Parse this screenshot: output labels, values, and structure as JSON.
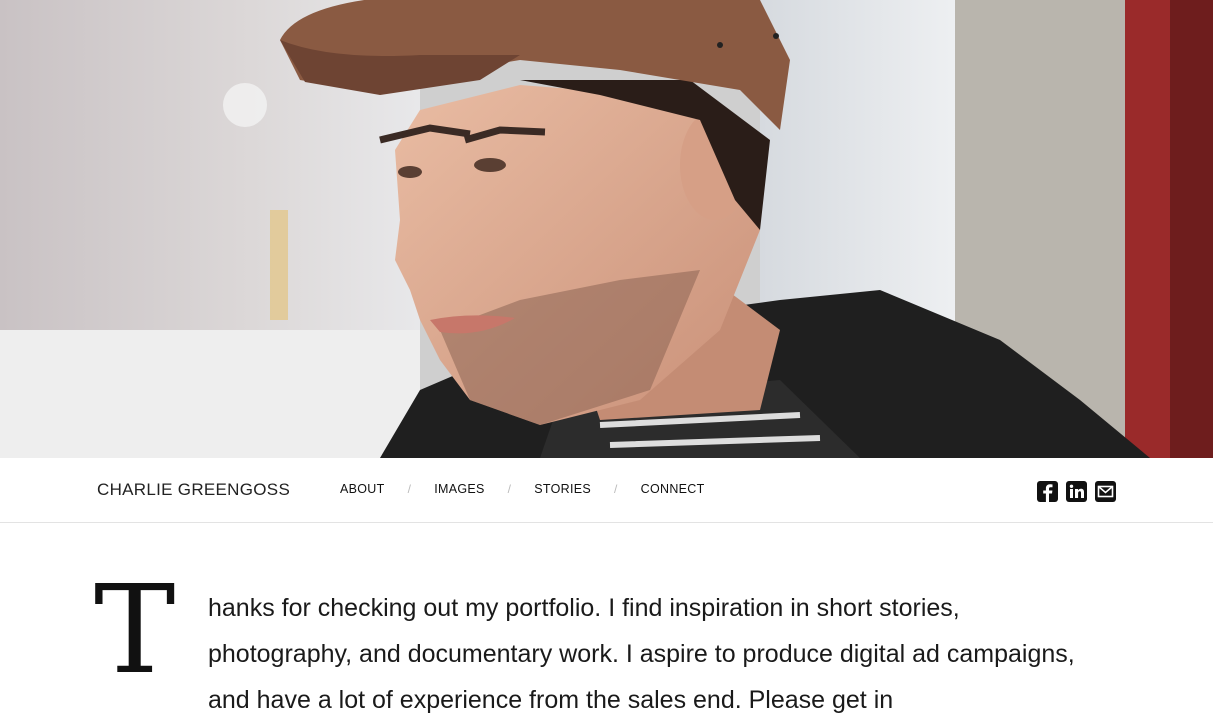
{
  "header": {
    "site_name": "CHARLIE GREENGOSS"
  },
  "nav": {
    "items": [
      {
        "label": "ABOUT"
      },
      {
        "label": "IMAGES"
      },
      {
        "label": "STORIES"
      },
      {
        "label": "CONNECT"
      }
    ],
    "separator": "/"
  },
  "social": {
    "items": [
      {
        "icon": "facebook-icon"
      },
      {
        "icon": "linkedin-icon"
      },
      {
        "icon": "email-icon"
      }
    ]
  },
  "intro": {
    "dropcap": "T",
    "text": "hanks for checking out my portfolio. I find inspiration in short stories, photography, and documentary work. I aspire to produce digital ad campaigns, and have a lot of experience from the sales end. Please get in"
  },
  "colors": {
    "text": "#111111",
    "divider": "#e3e3e3",
    "icon_bg": "#111111"
  }
}
